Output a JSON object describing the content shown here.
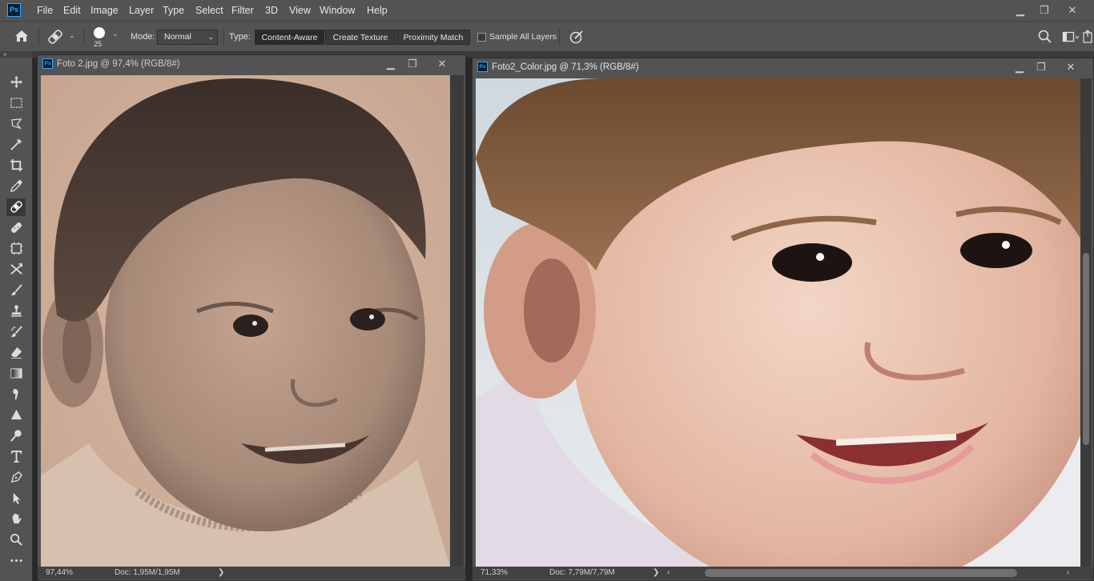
{
  "app": {
    "logo": "Ps"
  },
  "menu": [
    "File",
    "Edit",
    "Image",
    "Layer",
    "Type",
    "Select",
    "Filter",
    "3D",
    "View",
    "Window",
    "Help"
  ],
  "window_controls": {
    "minimize": "▁",
    "restore": "❐",
    "close": "✕"
  },
  "options": {
    "brush_size": "25",
    "mode_label": "Mode:",
    "mode_value": "Normal",
    "type_label": "Type:",
    "type_buttons": [
      "Content-Aware",
      "Create Texture",
      "Proximity Match"
    ],
    "active_type": "Content-Aware",
    "sample_all_layers": "Sample All Layers",
    "sample_all_layers_checked": false
  },
  "tools": [
    {
      "name": "move-tool",
      "icon": "move-icon"
    },
    {
      "name": "marquee-tool",
      "icon": "marquee-icon"
    },
    {
      "name": "lasso-tool",
      "icon": "lasso-icon"
    },
    {
      "name": "magic-wand-tool",
      "icon": "magic-wand-icon"
    },
    {
      "name": "crop-tool",
      "icon": "crop-icon"
    },
    {
      "name": "eyedropper-tool",
      "icon": "eyedropper-icon"
    },
    {
      "name": "spot-healing-tool",
      "icon": "bandage-icon",
      "selected": true
    },
    {
      "name": "healing-brush-tool",
      "icon": "bandage-icon"
    },
    {
      "name": "patch-tool",
      "icon": "patch-icon"
    },
    {
      "name": "content-aware-move-tool",
      "icon": "cross-arrows-icon"
    },
    {
      "name": "brush-tool",
      "icon": "brush-icon"
    },
    {
      "name": "clone-stamp-tool",
      "icon": "stamp-icon"
    },
    {
      "name": "history-brush-tool",
      "icon": "history-brush-icon"
    },
    {
      "name": "eraser-tool",
      "icon": "eraser-icon"
    },
    {
      "name": "gradient-tool",
      "icon": "gradient-icon"
    },
    {
      "name": "blur-tool",
      "icon": "smudge-icon"
    },
    {
      "name": "sharpen-tool",
      "icon": "triangle-icon"
    },
    {
      "name": "dodge-tool",
      "icon": "dodge-icon"
    },
    {
      "name": "type-tool",
      "icon": "type-icon"
    },
    {
      "name": "pen-tool",
      "icon": "pen-icon"
    },
    {
      "name": "path-selection-tool",
      "icon": "arrow-icon"
    },
    {
      "name": "hand-tool",
      "icon": "hand-icon"
    },
    {
      "name": "zoom-tool",
      "icon": "zoom-icon"
    },
    {
      "name": "more-tools",
      "icon": "more-icon"
    }
  ],
  "documents": [
    {
      "title": "Foto 2.jpg @ 97,4% (RGB/8#)",
      "zoom": "97,44%",
      "doc_info": "Doc: 1,95M/1,95M",
      "expand_arrow": "❯"
    },
    {
      "title": "Foto2_Color.jpg @ 71,3% (RGB/8#)",
      "zoom": "71,33%",
      "doc_info": "Doc: 7,79M/7,79M",
      "expand_arrow": "❯",
      "scroll_left": "‹",
      "scroll_right": "›"
    }
  ],
  "colors": {
    "ui_bg": "#535353",
    "workspace": "#282828",
    "accent": "#31a8ff"
  }
}
